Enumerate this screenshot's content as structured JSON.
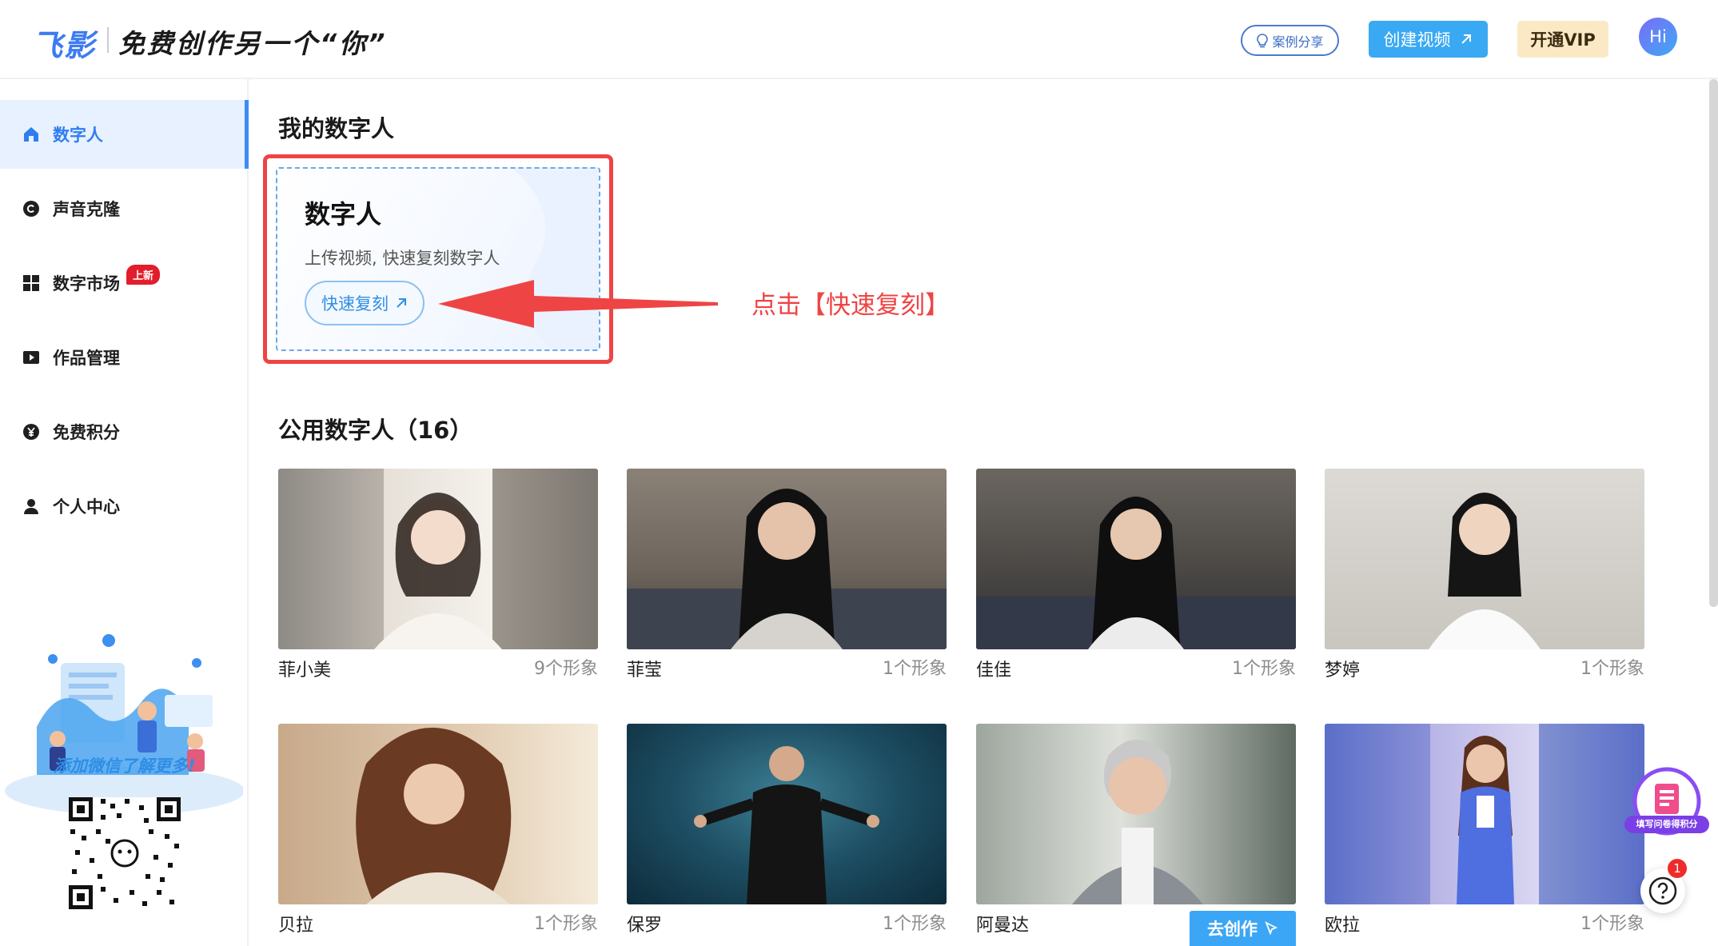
{
  "header": {
    "logo": "飞影",
    "slogan": "免费创作另一个“你”",
    "cases_button": "案例分享",
    "create_video_button": "创建视频",
    "vip_button": "开通VIP",
    "avatar_text": "Hi"
  },
  "sidebar": {
    "items": [
      {
        "label": "数字人",
        "icon": "home-icon",
        "active": true
      },
      {
        "label": "声音克隆",
        "icon": "copyright-circle-icon"
      },
      {
        "label": "数字市场",
        "icon": "grid-icon",
        "badge": "上新"
      },
      {
        "label": "作品管理",
        "icon": "play-square-icon"
      },
      {
        "label": "免费积分",
        "icon": "yen-circle-icon"
      },
      {
        "label": "个人中心",
        "icon": "user-icon"
      }
    ],
    "promo_text": "添加微信了解更多!"
  },
  "my_section": {
    "title": "我的数字人",
    "card_title": "数字人",
    "card_subtitle": "上传视频, 快速复刻数字人",
    "quick_button": "快速复刻",
    "annotation": "点击【快速复刻】"
  },
  "public_section": {
    "title": "公用数字人（16）",
    "go_create": "去创作",
    "cards": [
      {
        "name": "菲小美",
        "count": "9个形象",
        "colors": [
          "#b8b2aa",
          "#e6e0d8",
          "#f5f1ec"
        ]
      },
      {
        "name": "菲莹",
        "count": "1个形象",
        "colors": [
          "#3f3b36",
          "#8a8177",
          "#c9c3bb"
        ]
      },
      {
        "name": "佳佳",
        "count": "1个形象",
        "colors": [
          "#2c2e33",
          "#6b6660",
          "#b7b0a6"
        ]
      },
      {
        "name": "梦婷",
        "count": "1个形象",
        "colors": [
          "#c9c6c0",
          "#dddad5",
          "#f3f2ef"
        ]
      },
      {
        "name": "贝拉",
        "count": "1个形象",
        "colors": [
          "#c8a98a",
          "#e2cdb3",
          "#f4ead9"
        ]
      },
      {
        "name": "保罗",
        "count": "1个形象",
        "colors": [
          "#0d2c3b",
          "#1d4d62",
          "#3d7f94"
        ]
      },
      {
        "name": "阿曼达",
        "count": "",
        "colors": [
          "#5e6a62",
          "#9da69e",
          "#dfe2dc"
        ]
      },
      {
        "name": "欧拉",
        "count": "1个形象",
        "colors": [
          "#5b6fc8",
          "#b8b4e6",
          "#d9d7f2"
        ]
      }
    ]
  },
  "widgets": {
    "survey_text": "填写问卷得积分",
    "help_badge": "1"
  },
  "colors": {
    "accent": "#39a9f3",
    "active_nav": "#2f7ef0",
    "annotation_red": "#ef4444"
  }
}
